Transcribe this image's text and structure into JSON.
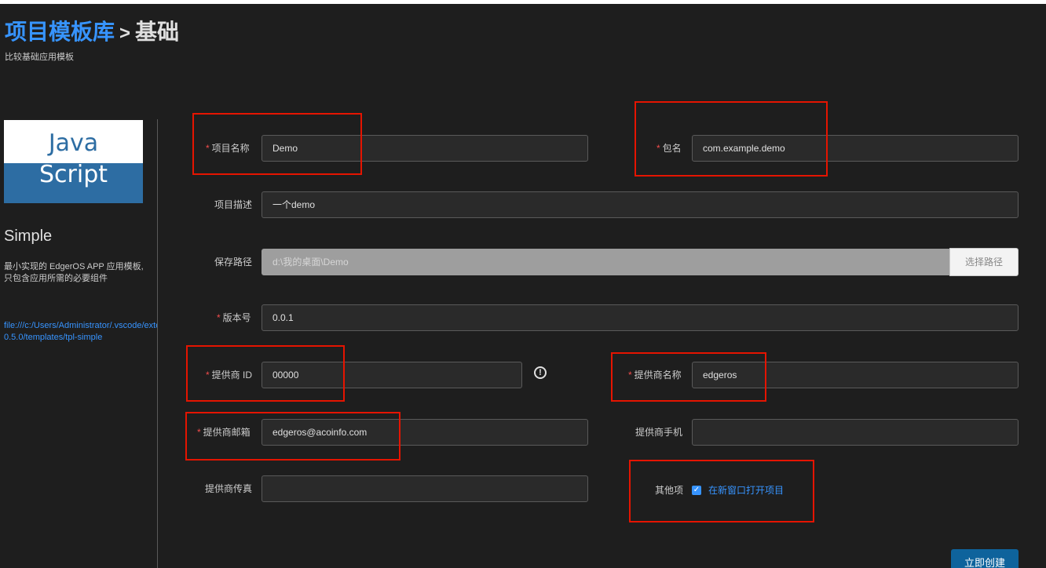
{
  "header": {
    "crumb_root": "项目模板库",
    "crumb_sep": ">",
    "crumb_current": "基础",
    "subtitle": "比较基础应用模板"
  },
  "template": {
    "logo_line1": "Java",
    "logo_line2": "Script",
    "name": "Simple",
    "description": "最小实现的 EdgerOS APP 应用模板, 只包含应用所需的必要组件",
    "path_line1": "file:///c:/Users/Administrator/.vscode/extensions/",
    "path_line2": "0.5.0/templates/tpl-simple"
  },
  "form": {
    "required_mark": "*",
    "project_name": {
      "label": "项目名称",
      "value": "Demo"
    },
    "package_name": {
      "label": "包名",
      "value": "com.example.demo"
    },
    "project_desc": {
      "label": "项目描述",
      "value": "一个demo"
    },
    "save_path": {
      "label": "保存路径",
      "value": "d:\\我的桌面\\Demo",
      "button": "选择路径"
    },
    "version": {
      "label": "版本号",
      "value": "0.0.1"
    },
    "vendor_id": {
      "label": "提供商 ID",
      "value": "00000",
      "info_icon": "!"
    },
    "vendor_name": {
      "label": "提供商名称",
      "value": "edgeros"
    },
    "vendor_email": {
      "label": "提供商邮箱",
      "value": "edgeros@acoinfo.com"
    },
    "vendor_phone": {
      "label": "提供商手机",
      "value": ""
    },
    "vendor_fax": {
      "label": "提供商传真",
      "value": ""
    },
    "other": {
      "label": "其他项",
      "checkbox_label": "在新窗口打开项目",
      "checked": true,
      "check_glyph": "✓"
    },
    "submit_label": "立即创建"
  },
  "colors": {
    "background": "#1e1e1e",
    "accent": "#3794ff",
    "highlight_box": "#e51400",
    "required": "#f14c4c",
    "primary_button": "#0e639c"
  },
  "icons": [
    "info-icon",
    "checkbox-checked-icon",
    "javascript-logo"
  ]
}
